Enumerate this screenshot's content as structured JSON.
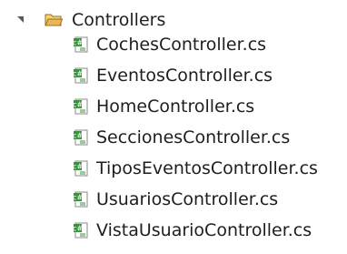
{
  "tree": {
    "folder": {
      "label": "Controllers",
      "icon": "folder-open-icon",
      "expanded": true
    },
    "files": [
      {
        "label": "CochesController.cs",
        "icon": "csharp-file-icon"
      },
      {
        "label": "EventosController.cs",
        "icon": "csharp-file-icon"
      },
      {
        "label": "HomeController.cs",
        "icon": "csharp-file-icon"
      },
      {
        "label": "SeccionesController.cs",
        "icon": "csharp-file-icon"
      },
      {
        "label": "TiposEventosController.cs",
        "icon": "csharp-file-icon"
      },
      {
        "label": "UsuariosController.cs",
        "icon": "csharp-file-icon"
      },
      {
        "label": "VistaUsuarioController.cs",
        "icon": "csharp-file-icon"
      }
    ]
  },
  "colors": {
    "text": "#1e1e1e",
    "folder_fill": "#e7b75a",
    "folder_stroke": "#9b6f1f",
    "file_green": "#3b8f3e",
    "expander": "#595959"
  }
}
